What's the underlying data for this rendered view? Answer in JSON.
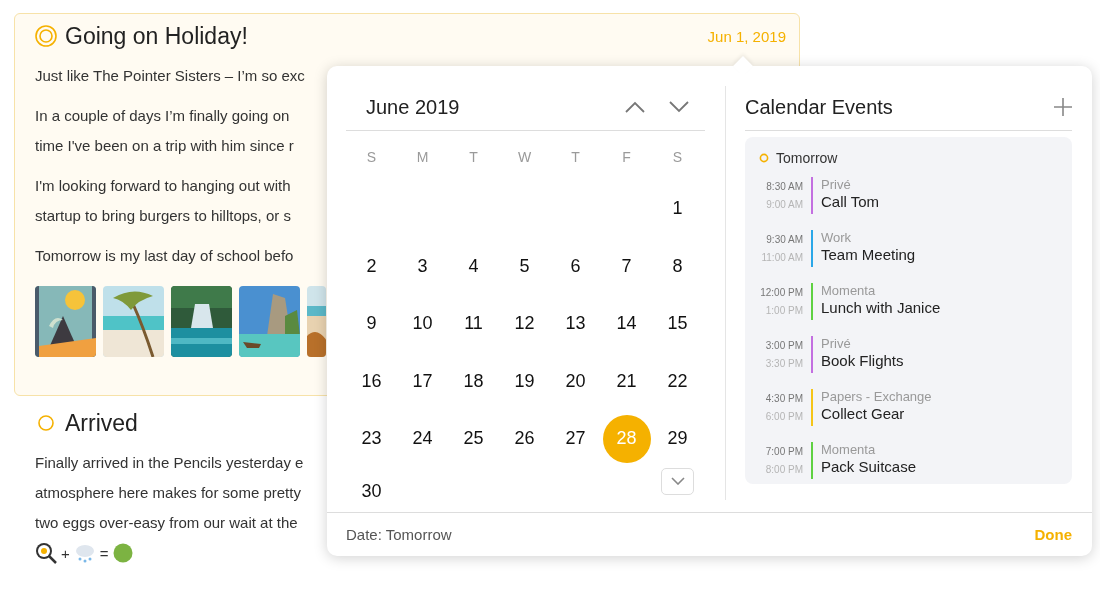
{
  "entries": [
    {
      "title": "Going on Holiday!",
      "date": "Jun 1, 2019",
      "selected": true,
      "paragraphs": [
        [
          "Just like The Pointer Sisters – I’m so exc"
        ],
        [
          "In a couple of days I’m finally going on",
          "time I've been on a trip with him since r"
        ],
        [
          "I'm looking forward to hanging out with",
          "startup to bring burgers to hilltops, or s"
        ],
        [
          "Tomorrow is my last day of school befo"
        ]
      ],
      "photos": [
        {
          "kind": "picture"
        },
        {
          "kind": "picture"
        },
        {
          "kind": "picture"
        },
        {
          "kind": "picture"
        },
        {
          "kind": "picture"
        }
      ]
    },
    {
      "title": "Arrived",
      "selected": false,
      "paragraphs": [
        [
          "Finally arrived in the Pencils yesterday e",
          "atmosphere here makes for some pretty",
          "two eggs over-easy from our wait at the"
        ]
      ],
      "emoji_line": [
        "+",
        "="
      ]
    }
  ],
  "date_picker": {
    "month": "June 2019",
    "weekdays": [
      "S",
      "M",
      "T",
      "W",
      "T",
      "F",
      "S"
    ],
    "weeks": [
      [
        {
          "day": "1",
          "selected": false
        }
      ],
      [
        {
          "day": "2",
          "selected": false
        },
        {
          "day": "3",
          "selected": false
        },
        {
          "day": "4",
          "selected": false
        },
        {
          "day": "5",
          "selected": false
        },
        {
          "day": "6",
          "selected": false
        },
        {
          "day": "7",
          "selected": false
        },
        {
          "day": "8",
          "selected": false
        }
      ],
      [
        {
          "day": "9",
          "selected": false
        },
        {
          "day": "10",
          "selected": false
        },
        {
          "day": "11",
          "selected": false
        },
        {
          "day": "12",
          "selected": false
        },
        {
          "day": "13",
          "selected": false
        },
        {
          "day": "14",
          "selected": false
        },
        {
          "day": "15",
          "selected": false
        }
      ],
      [
        {
          "day": "16",
          "selected": false
        },
        {
          "day": "17",
          "selected": false
        },
        {
          "day": "18",
          "selected": false
        },
        {
          "day": "19",
          "selected": false
        },
        {
          "day": "20",
          "selected": false
        },
        {
          "day": "21",
          "selected": false
        },
        {
          "day": "22",
          "selected": false
        }
      ],
      [
        {
          "day": "23",
          "selected": false
        },
        {
          "day": "24",
          "selected": false
        },
        {
          "day": "25",
          "selected": false
        },
        {
          "day": "26",
          "selected": false
        },
        {
          "day": "27",
          "selected": false
        },
        {
          "day": "28",
          "selected": true
        },
        {
          "day": "29",
          "selected": false
        }
      ],
      [
        {
          "day": "30",
          "selected": false
        }
      ]
    ],
    "events_title": "Calendar Events",
    "day_label": "Tomorrow",
    "events": [
      {
        "start": "8:30 AM",
        "end": "9:00 AM",
        "calendar": "Privé",
        "title": "Call Tom",
        "color": "#c36fe0"
      },
      {
        "start": "9:30 AM",
        "end": "11:00 AM",
        "calendar": "Work",
        "title": "Team Meeting",
        "color": "#2aa7e8"
      },
      {
        "start": "12:00 PM",
        "end": "1:00 PM",
        "calendar": "Momenta",
        "title": "Lunch with Janice",
        "color": "#5fd142"
      },
      {
        "start": "3:00 PM",
        "end": "3:30 PM",
        "calendar": "Privé",
        "title": "Book Flights",
        "color": "#c36fe0"
      },
      {
        "start": "4:30 PM",
        "end": "6:00 PM",
        "calendar": "Papers - Exchange",
        "title": "Collect Gear",
        "color": "#f5c518"
      },
      {
        "start": "7:00 PM",
        "end": "8:00 PM",
        "calendar": "Momenta",
        "title": "Pack Suitcase",
        "color": "#5fd142"
      }
    ],
    "footer_label": "Date: Tomorrow",
    "done": "Done"
  }
}
